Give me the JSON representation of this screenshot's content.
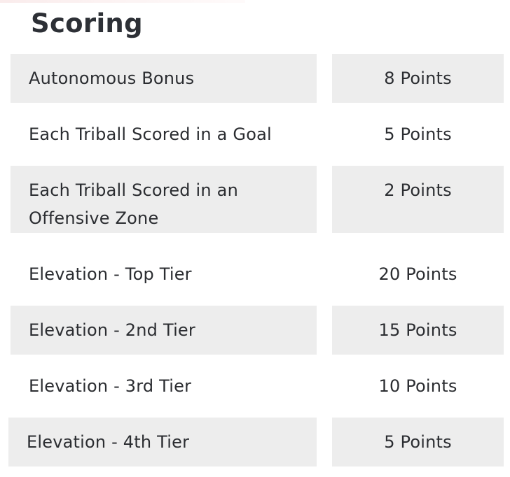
{
  "section": {
    "title": "Scoring"
  },
  "rows": [
    {
      "label": "Autonomous Bonus",
      "points": "8 Points"
    },
    {
      "label": "Each Triball Scored in a Goal",
      "points": "5 Points"
    },
    {
      "label": "Each Triball Scored in an Offensive Zone",
      "points": "2 Points"
    },
    {
      "label": "Elevation - Top Tier",
      "points": "20 Points"
    },
    {
      "label": "Elevation - 2nd Tier",
      "points": "15 Points"
    },
    {
      "label": "Elevation - 3rd Tier",
      "points": "10 Points"
    },
    {
      "label": "Elevation - 4th Tier",
      "points": "5 Points"
    }
  ],
  "colors": {
    "shaded_row_background": "#ededed",
    "text": "#2b2d31",
    "page_background": "#ffffff"
  }
}
